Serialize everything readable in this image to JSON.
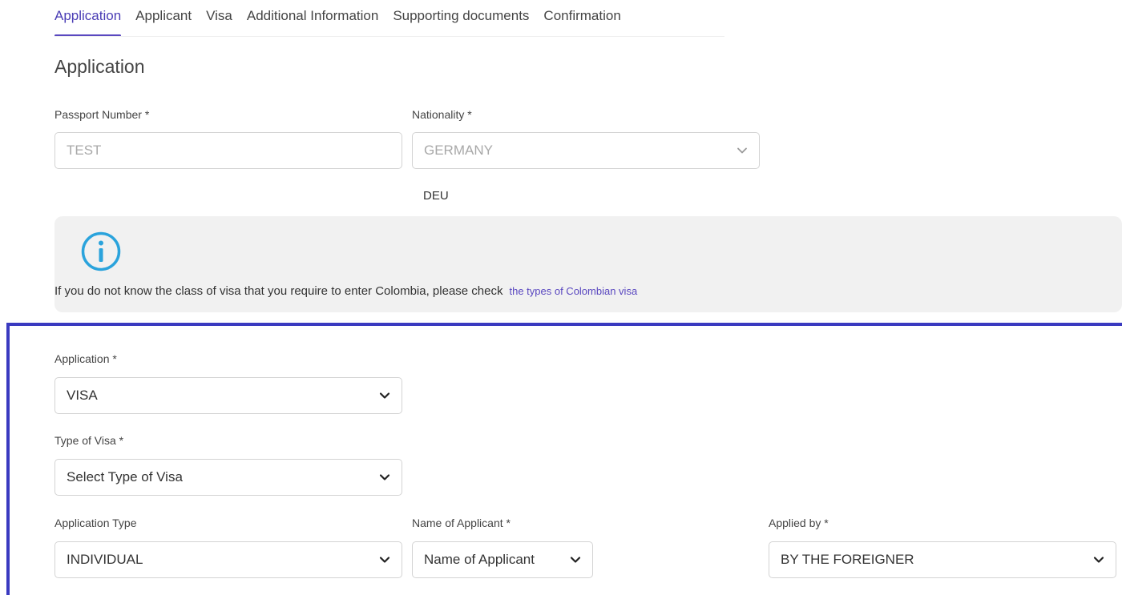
{
  "tabs": [
    {
      "label": "Application",
      "active": true
    },
    {
      "label": "Applicant"
    },
    {
      "label": "Visa"
    },
    {
      "label": "Additional Information"
    },
    {
      "label": "Supporting documents"
    },
    {
      "label": "Confirmation"
    }
  ],
  "page_title": "Application",
  "passport": {
    "label": "Passport Number *",
    "value": "TEST"
  },
  "nationality": {
    "label": "Nationality *",
    "value": "GERMANY",
    "code": "DEU"
  },
  "info": {
    "icon": "info-icon",
    "text": "If you do not know the class of visa that you require to enter Colombia, please check",
    "link": "the types of Colombian visa"
  },
  "application": {
    "label": "Application *",
    "value": "VISA"
  },
  "visa_type": {
    "label": "Type of Visa *",
    "value": "Select Type of Visa"
  },
  "application_type": {
    "label": "Application Type",
    "value": "INDIVIDUAL"
  },
  "applicant_name": {
    "label": "Name of Applicant *",
    "value": "Name of Applicant"
  },
  "applied_by": {
    "label": "Applied by *",
    "value": "BY THE FOREIGNER"
  },
  "colors": {
    "accent": "#5a48c0",
    "highlight_border": "#3a3ac0",
    "info_icon": "#2aa3dc",
    "info_bg": "#f1f1f1"
  }
}
